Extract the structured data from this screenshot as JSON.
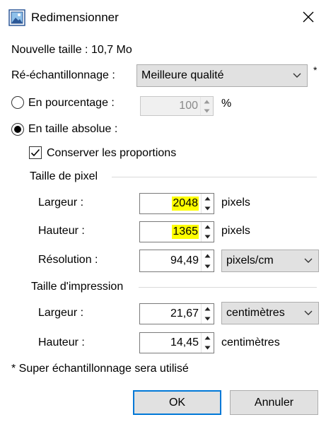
{
  "window": {
    "title": "Redimensionner",
    "close_glyph": "close-icon"
  },
  "new_size": "Nouvelle taille : 10,7 Mo",
  "resampling": {
    "label": "Ré-échantillonnage :",
    "value": "Meilleure qualité",
    "asterisk": "*"
  },
  "percentage": {
    "label": "En pourcentage :",
    "value": "100",
    "unit": "%",
    "selected": false,
    "enabled": false
  },
  "absolute": {
    "label": "En taille absolue :",
    "selected": true
  },
  "keep_proportions": {
    "label": "Conserver les proportions",
    "checked": true
  },
  "pixel_group": {
    "title": "Taille de pixel",
    "width_label": "Largeur :",
    "width_value": "2048",
    "width_unit": "pixels",
    "height_label": "Hauteur :",
    "height_value": "1365",
    "height_unit": "pixels",
    "resolution_label": "Résolution :",
    "resolution_value": "94,49",
    "resolution_unit": "pixels/cm"
  },
  "print_group": {
    "title": "Taille d'impression",
    "width_label": "Largeur :",
    "width_value": "21,67",
    "width_unit": "centimètres",
    "height_label": "Hauteur :",
    "height_value": "14,45",
    "height_unit": "centimètres"
  },
  "footnote": "* Super échantillonnage sera utilisé",
  "buttons": {
    "ok": "OK",
    "cancel": "Annuler"
  },
  "colors": {
    "highlight": "#ffff00",
    "default_button_border": "#0078d7"
  }
}
